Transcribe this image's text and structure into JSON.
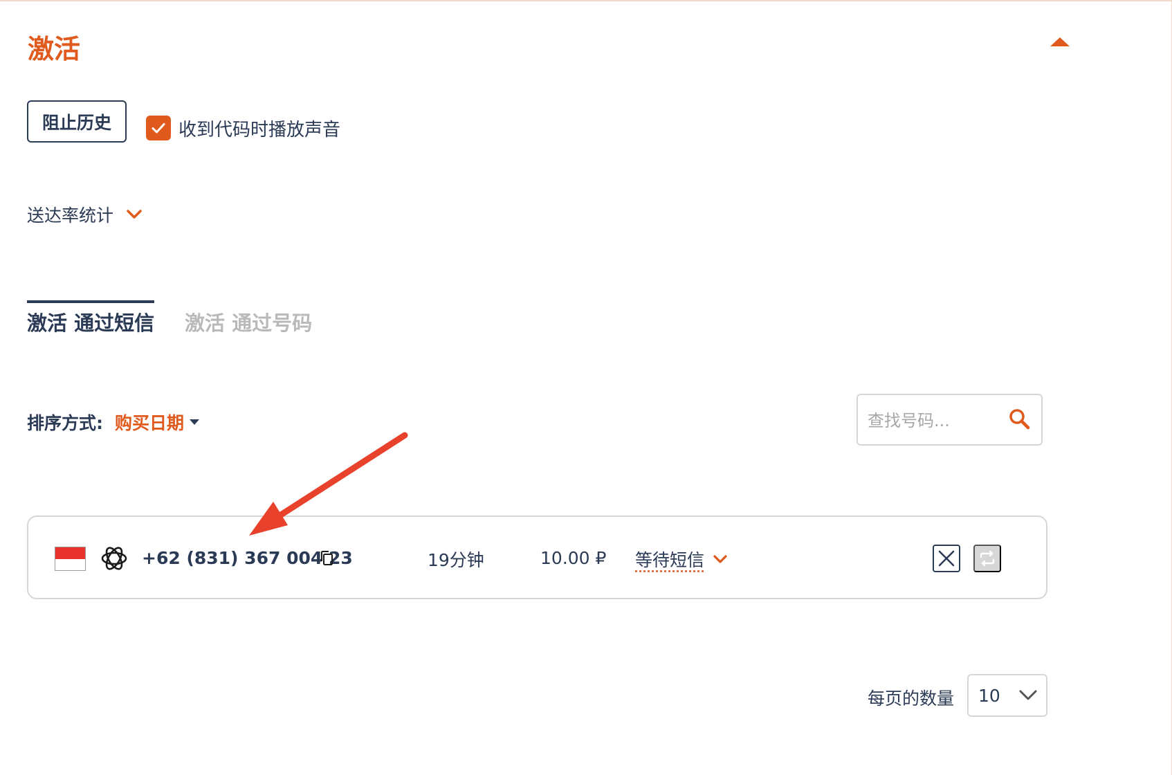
{
  "section": {
    "title": "激活",
    "collapse_icon": "caret-up-icon"
  },
  "controls": {
    "block_history_label": "阻止历史",
    "sound_checkbox_label": "收到代码时播放声音",
    "sound_checkbox_checked": true,
    "stats_toggle_label": "送达率统计"
  },
  "tabs": [
    {
      "label": "激活 通过短信",
      "active": true
    },
    {
      "label": "激活 通过号码",
      "active": false
    }
  ],
  "sort": {
    "label": "排序方式:",
    "value": "购买日期"
  },
  "search": {
    "placeholder": "查找号码..."
  },
  "activations": [
    {
      "country_flag": "indonesia-flag",
      "service_icon": "openai-icon",
      "phone": "+62 (831) 367 004 23",
      "time_left": "19分钟",
      "price": "10.00 ₽",
      "status": "等待短信"
    }
  ],
  "pagination": {
    "per_page_label": "每页的数量",
    "per_page_value": "10"
  },
  "colors": {
    "accent": "#e05a1e",
    "text": "#2b3a55",
    "muted": "#b9b9b9",
    "border": "#d6d6d6",
    "annotation_arrow": "#e8412c"
  }
}
